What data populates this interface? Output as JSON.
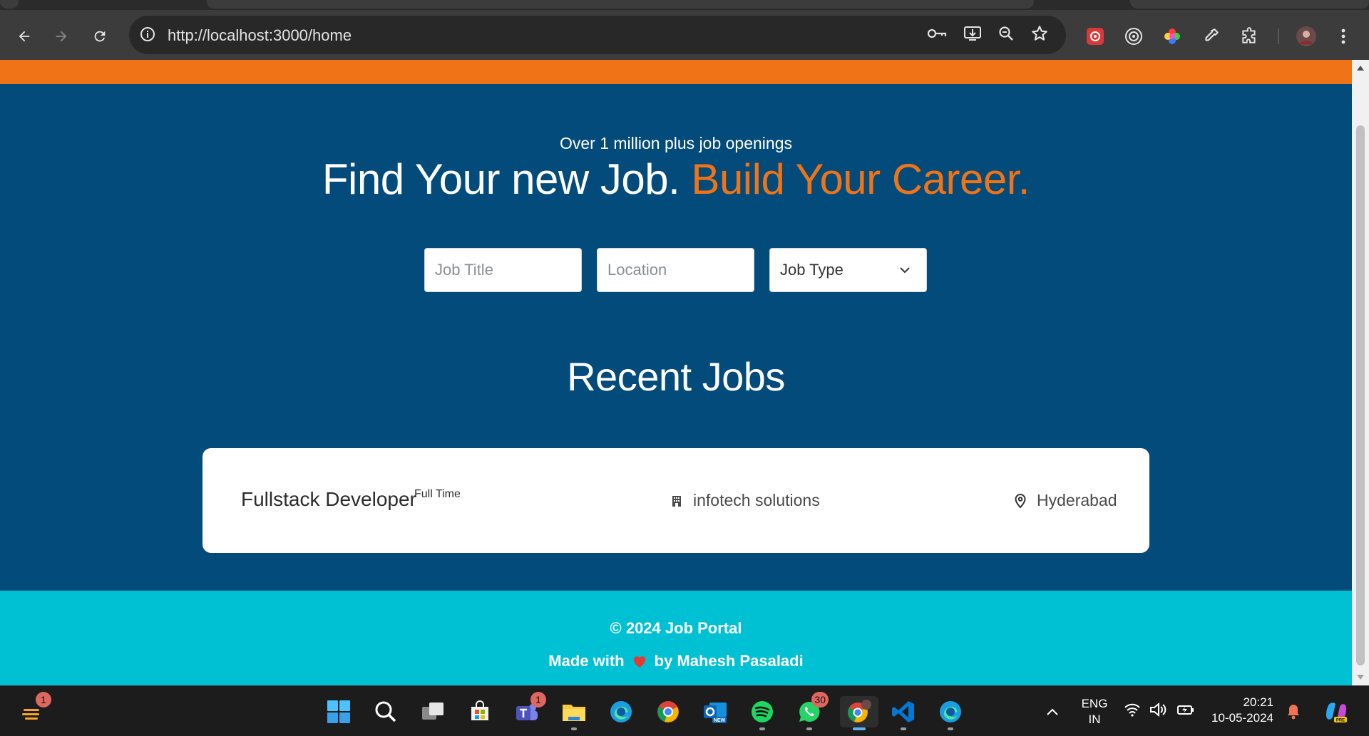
{
  "browser": {
    "url": "http://localhost:3000/home"
  },
  "hero": {
    "subtitle": "Over 1 million plus job openings",
    "title_main": "Find Your new Job.",
    "title_accent": "Build Your Career."
  },
  "search": {
    "job_title_placeholder": "Job Title",
    "location_placeholder": "Location",
    "job_type_label": "Job Type"
  },
  "recent": {
    "heading": "Recent Jobs",
    "jobs": [
      {
        "title": "Fullstack Developer",
        "type": "Full Time",
        "company": "infotech solutions",
        "location": "Hyderabad"
      }
    ]
  },
  "footer": {
    "copyright": "© 2024 Job Portal",
    "made_with": "Made with",
    "by": "by Mahesh Pasaladi"
  },
  "taskbar": {
    "widgets_badge": "1",
    "teams_badge": "1",
    "whatsapp_badge": "30",
    "lang_line1": "ENG",
    "lang_line2": "IN",
    "time": "20:21",
    "date": "10-05-2024"
  },
  "colors": {
    "accent_orange": "#f07317",
    "hero_blue": "#034b7a",
    "footer_cyan": "#00c1d4"
  }
}
